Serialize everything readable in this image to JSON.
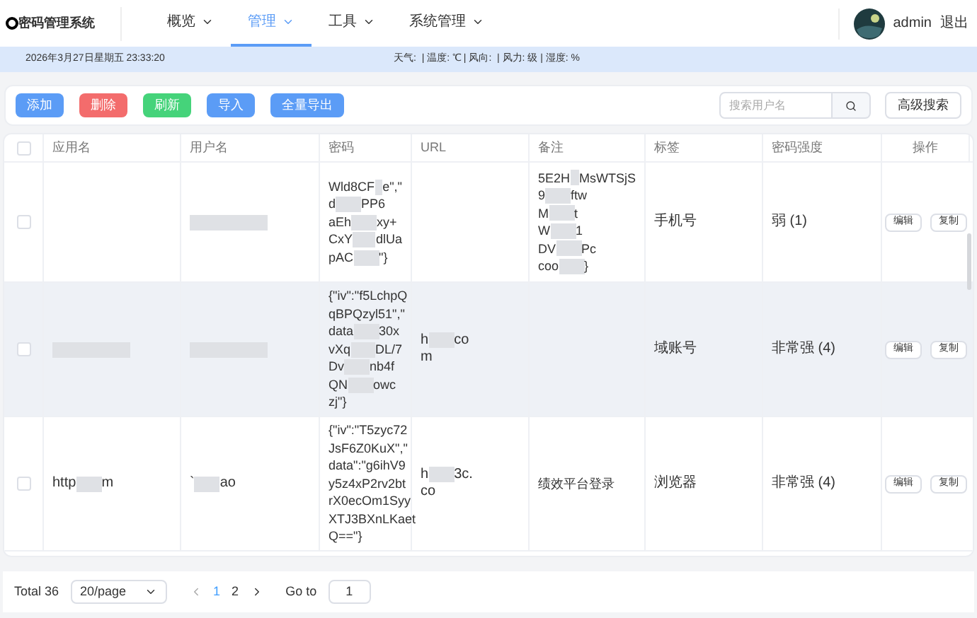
{
  "logo": "密码管理系统",
  "nav": [
    {
      "label": "概览",
      "selected": false
    },
    {
      "label": "管理",
      "selected": true
    },
    {
      "label": "工具",
      "selected": false
    },
    {
      "label": "系统管理",
      "selected": false
    }
  ],
  "user": {
    "name": "admin",
    "logout": "退出"
  },
  "info_bar": {
    "datetime": "2026年3月27日星期五 23:33:20",
    "weather": "天气:  | 温度: ℃ | 风向:  | 风力: 级 | 湿度: %"
  },
  "toolbar": {
    "buttons": [
      {
        "label": "添加",
        "kind": "primary"
      },
      {
        "label": "删除",
        "kind": "danger"
      },
      {
        "label": "刷新",
        "kind": "success"
      },
      {
        "label": "导入",
        "kind": "primary"
      },
      {
        "label": "全量导出",
        "kind": "primary"
      }
    ],
    "search": {
      "placeholder": "搜索用户名"
    },
    "advanced": "高级搜索"
  },
  "table": {
    "columns": [
      "应用名",
      "用户名",
      "密码",
      "URL",
      "备注",
      "标签",
      "密码强度",
      "操作"
    ],
    "header_checked": false,
    "rows": [
      {
        "checked": false,
        "highlighted": false,
        "cells": [
          {},
          {
            "redacted": true
          },
          {
            "lines": [
              [
                "Wld8CF",
                "e\",\""
              ],
              [
                "d",
                "PP6"
              ],
              [
                "aEh",
                "xy+"
              ],
              [
                "CxY",
                "dlUa"
              ],
              [
                "pAC",
                "\"}"
              ]
            ]
          },
          {},
          {
            "lines": [
              [
                "5E2H",
                "MsWTSjS"
              ],
              [
                "9",
                "ftw"
              ],
              [
                "M",
                "t"
              ],
              [
                "W",
                "1"
              ],
              [
                "DV",
                "Pc"
              ],
              [
                "coo",
                "}"
              ]
            ]
          },
          {
            "lines": [
              [
                "手机号"
              ]
            ]
          },
          {
            "lines": [
              [
                "弱 (1)"
              ]
            ]
          }
        ],
        "actions": [
          "编辑",
          "复制"
        ]
      },
      {
        "checked": false,
        "highlighted": true,
        "cells": [
          {
            "redacted": true
          },
          {
            "redacted": true
          },
          {
            "lines": [
              [
                "{\"iv\":\"f5LchpQ"
              ],
              [
                "qBPQzyl51\",\""
              ],
              [
                "data",
                "30x"
              ],
              [
                "vXq",
                "DL/7"
              ],
              [
                "Dv",
                "nb4f"
              ],
              [
                "QN",
                "owc"
              ],
              [
                "zj\"}"
              ]
            ]
          },
          {
            "lines": [
              [
                "h",
                "co"
              ],
              [
                "m"
              ]
            ]
          },
          {},
          {
            "lines": [
              [
                "域账号"
              ]
            ]
          },
          {
            "lines": [
              [
                "非常强 (4)"
              ]
            ]
          }
        ],
        "actions": [
          "编辑",
          "复制"
        ]
      },
      {
        "checked": false,
        "highlighted": false,
        "cells": [
          {
            "lines": [
              [
                "http",
                "m"
              ]
            ]
          },
          {
            "lines": [
              [
                "`",
                "ao"
              ]
            ]
          },
          {
            "lines": [
              [
                "{\"iv\":\"T5zyc72"
              ],
              [
                "JsF6Z0KuX\",\""
              ],
              [
                "data\":\"g6ihV9"
              ],
              [
                "y5z4xP2rv2bt"
              ],
              [
                "rX0ecOm1Syy"
              ],
              [
                "XTJ3BXnLKaet"
              ],
              [
                "Q==\"}"
              ]
            ]
          },
          {
            "lines": [
              [
                "h",
                "3c."
              ],
              [
                "co"
              ]
            ]
          },
          {
            "lines": [
              [
                "绩效平台登录"
              ]
            ]
          },
          {
            "lines": [
              [
                "浏览器"
              ]
            ]
          },
          {
            "lines": [
              [
                "非常强 (4)"
              ]
            ]
          }
        ],
        "actions": [
          "编辑",
          "复制"
        ]
      }
    ]
  },
  "pagination": {
    "total": "Total 36",
    "page_size": "20/page",
    "pages": [
      {
        "label": "1",
        "selected": true
      },
      {
        "label": "2",
        "selected": false
      }
    ],
    "goto_label": "Go to",
    "goto_value": "1"
  }
}
